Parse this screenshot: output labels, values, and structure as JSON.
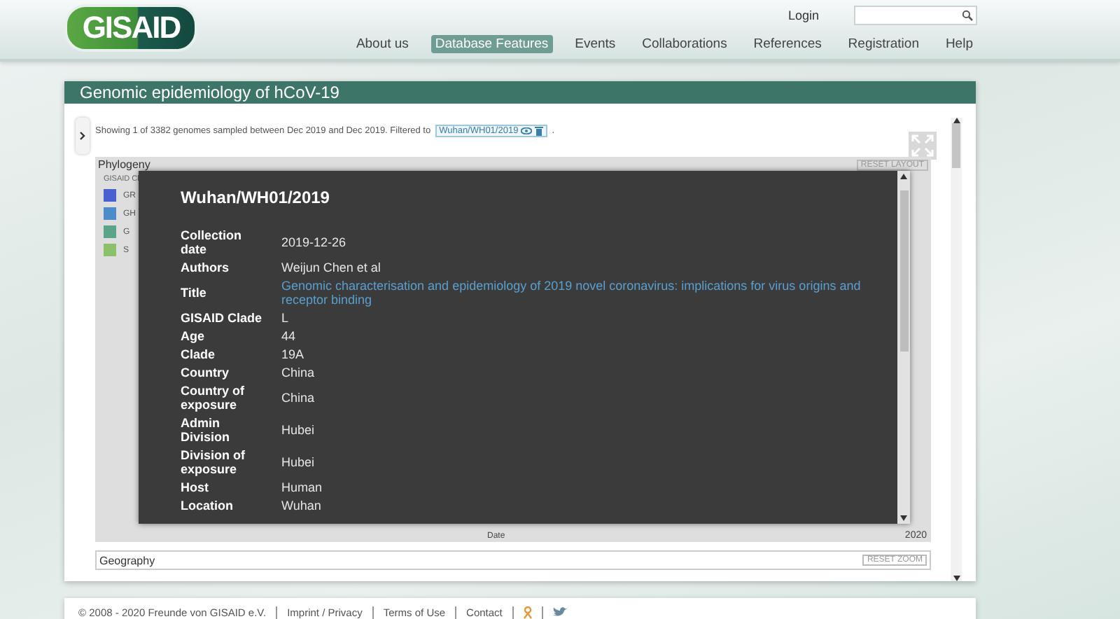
{
  "header": {
    "logo": "GISAID",
    "login": "Login"
  },
  "nav": [
    {
      "label": "About us",
      "selected": false
    },
    {
      "label": "Database Features",
      "selected": true
    },
    {
      "label": "Events",
      "selected": false
    },
    {
      "label": "Collaborations",
      "selected": false
    },
    {
      "label": "References",
      "selected": false
    },
    {
      "label": "Registration",
      "selected": false
    },
    {
      "label": "Help",
      "selected": false
    }
  ],
  "panel": {
    "title": "Genomic epidemiology of hCoV-19",
    "summary": "Showing 1 of 3382 genomes sampled between Dec 2019 and Dec 2019. Filtered to",
    "filter": "Wuhan/WH01/2019",
    "summary_end": "."
  },
  "phylogeny": {
    "title": "Phylogeny",
    "reset": "RESET LAYOUT",
    "legend_title": "GISAID Cl",
    "legend": [
      {
        "label": "GR",
        "color": "#4a5fd0"
      },
      {
        "label": "GH",
        "color": "#4c8dc9"
      },
      {
        "label": "G",
        "color": "#5aa48a"
      },
      {
        "label": "S",
        "color": "#8cc06a"
      }
    ],
    "axis_label": "Date",
    "axis_tick": "2020"
  },
  "tooltip": {
    "title": "Wuhan/WH01/2019",
    "fields": [
      {
        "label": "Collection date",
        "value": "2019-12-26",
        "kind": "text"
      },
      {
        "label": "Authors",
        "value": "Weijun Chen et al",
        "kind": "text"
      },
      {
        "label": "Title",
        "value": "Genomic characterisation and epidemiology of 2019 novel coronavirus: implications for virus origins and receptor binding",
        "kind": "link"
      },
      {
        "label": "GISAID Clade",
        "value": "L",
        "kind": "text"
      },
      {
        "label": "Age",
        "value": "44",
        "kind": "text"
      },
      {
        "label": "Clade",
        "value": "19A",
        "kind": "text"
      },
      {
        "label": "Country",
        "value": "China",
        "kind": "text"
      },
      {
        "label": "Country of exposure",
        "value": "China",
        "kind": "text"
      },
      {
        "label": "Admin Division",
        "value": "Hubei",
        "kind": "text"
      },
      {
        "label": "Division of exposure",
        "value": "Hubei",
        "kind": "text"
      },
      {
        "label": "Host",
        "value": "Human",
        "kind": "text"
      },
      {
        "label": "Location",
        "value": "Wuhan",
        "kind": "text"
      }
    ]
  },
  "geography": {
    "title": "Geography",
    "reset": "RESET ZOOM"
  },
  "footer": {
    "copyright": "© 2008 - 2020  Freunde von GISAID e.V.",
    "links": [
      "Imprint / Privacy",
      "Terms of Use",
      "Contact"
    ]
  }
}
